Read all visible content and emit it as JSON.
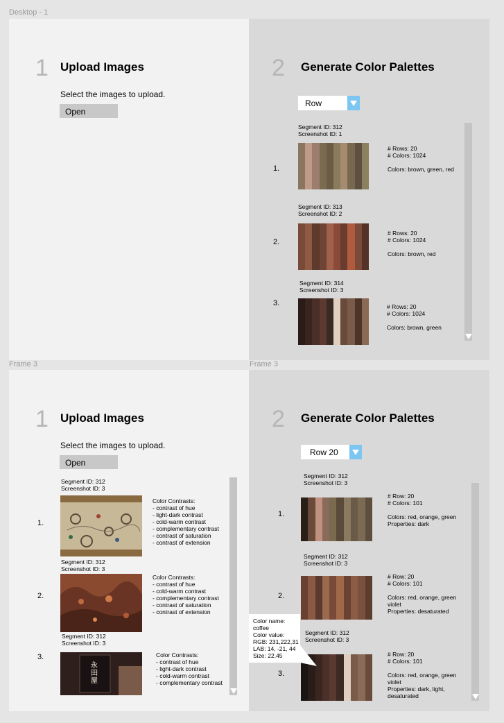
{
  "frame_labels": {
    "top": "Desktop - 1",
    "bottom_left": "Frame 3",
    "bottom_right": "Frame 3"
  },
  "upload": {
    "step": "1",
    "title": "Upload Images",
    "instruction": "Select the images to upload.",
    "button": "Open"
  },
  "generate": {
    "step": "2",
    "title": "Generate Color Palettes"
  },
  "top": {
    "select_value": "Row",
    "items": [
      {
        "index": "1.",
        "segment": "Segment ID: 312",
        "screenshot": "Screenshot ID: 1",
        "rows": "# Rows: 20",
        "colors_count": "# Colors: 1024",
        "colors": "Colors: brown, green, red",
        "palette": [
          "#8a7560",
          "#c09a88",
          "#9c7e70",
          "#7a6a50",
          "#6b5d45",
          "#8a7b5c",
          "#a58c70",
          "#786850",
          "#5e5040",
          "#8b8060"
        ]
      },
      {
        "index": "2.",
        "segment": "Segment ID: 313",
        "screenshot": "Screenshot ID: 2",
        "rows": "# Rows: 20",
        "colors_count": "# Colors: 1024",
        "colors": "Colors: brown, red",
        "palette": [
          "#7a4a38",
          "#8e5a44",
          "#5d3a2c",
          "#6e4434",
          "#a0604a",
          "#8a4a3a",
          "#6a3c30",
          "#b05a3e",
          "#7c4a38",
          "#553228"
        ]
      },
      {
        "index": "3.",
        "segment": "Segment ID: 314",
        "screenshot": "Screenshot ID: 3",
        "rows": "# Rows: 20",
        "colors_count": "# Colors: 1024",
        "colors": "Colors: brown, green",
        "palette": [
          "#2a1a18",
          "#3a2420",
          "#4a2e28",
          "#5c3a30",
          "#3a2a24",
          "#e0d0c0",
          "#6a4a3a",
          "#7a5a48",
          "#4c3428",
          "#8a6a54"
        ]
      }
    ]
  },
  "bottom_left": {
    "items": [
      {
        "index": "1.",
        "segment": "Segment ID: 312",
        "screenshot": "Screenshot ID: 3",
        "heading": "Color Contrasts:",
        "contrasts": [
          "- contrast of hue",
          "- light-dark contrast",
          "- cold-warm contrast",
          "- complementary contrast",
          "- contrast of saturation",
          "- contrast of extension"
        ]
      },
      {
        "index": "2.",
        "segment": "Segment ID: 312",
        "screenshot": "Screenshot ID: 3",
        "heading": "Color Contrasts:",
        "contrasts": [
          "- contrast of hue",
          "- cold-warm contrast",
          "- complementary contrast",
          "- contrast of saturation",
          "- contrast of extension"
        ]
      },
      {
        "index": "3.",
        "segment": "Segment ID: 312",
        "screenshot": "Screenshot ID: 3",
        "heading": "Color Contrasts:",
        "contrasts": [
          "- contrast of hue",
          "- light-dark contrast",
          "- cold-warm contrast",
          "- complementary contrast"
        ]
      }
    ],
    "sign_text": "永田屋"
  },
  "bottom_right": {
    "select_value": "Row 20",
    "items": [
      {
        "index": "1.",
        "segment": "Segment ID: 312",
        "screenshot": "Screenshot ID: 3",
        "rows": "# Row: 20",
        "colors_count": "# Colors: 101",
        "colors": [
          "Colors: red, orange, green"
        ],
        "properties": "Properties: dark",
        "palette": [
          "#2a1e18",
          "#6a4a3a",
          "#c09080",
          "#8a6a5a",
          "#7a6a50",
          "#5a4a3a",
          "#8a7a60",
          "#6a5a48",
          "#7c6a54",
          "#5e4e3e"
        ]
      },
      {
        "index": "2.",
        "segment": "Segment ID: 312",
        "screenshot": "Screenshot ID: 3",
        "rows": "# Row: 20",
        "colors_count": "# Colors: 101",
        "colors": [
          "Colors: red, orange, green",
          "violet"
        ],
        "properties": "Properties: desaturated",
        "palette": [
          "#6a4030",
          "#8a5a44",
          "#5a3a2c",
          "#9a6a50",
          "#7a4a38",
          "#a06848",
          "#6a4232",
          "#8c5c44",
          "#7a5040",
          "#5c3c2e"
        ]
      },
      {
        "index": "3.",
        "segment": "Segment ID: 312",
        "screenshot": "Screenshot ID: 3",
        "rows": "# Row: 20",
        "colors_count": "# Colors: 101",
        "colors": [
          "Colors: red, orange, green",
          "violet"
        ],
        "properties": "Properties: dark, light,",
        "properties2": "desaturated",
        "palette": [
          "#1a1412",
          "#2a1c18",
          "#3a2620",
          "#4a3028",
          "#5a3a30",
          "#3e2a24",
          "#e0cfc0",
          "#7a5a48",
          "#8a6a58",
          "#6a4a3a"
        ]
      }
    ],
    "tooltip": {
      "lines": [
        "Color name:",
        "coffee",
        "Color value:",
        "RGB: 231,222,31",
        "LAB: 14, -21, 44",
        "Size: 22.45"
      ]
    }
  },
  "colors": {
    "accent": "#7cc6f2",
    "panel_left": "#f2f2f2",
    "panel_right": "#d9d9d9"
  }
}
